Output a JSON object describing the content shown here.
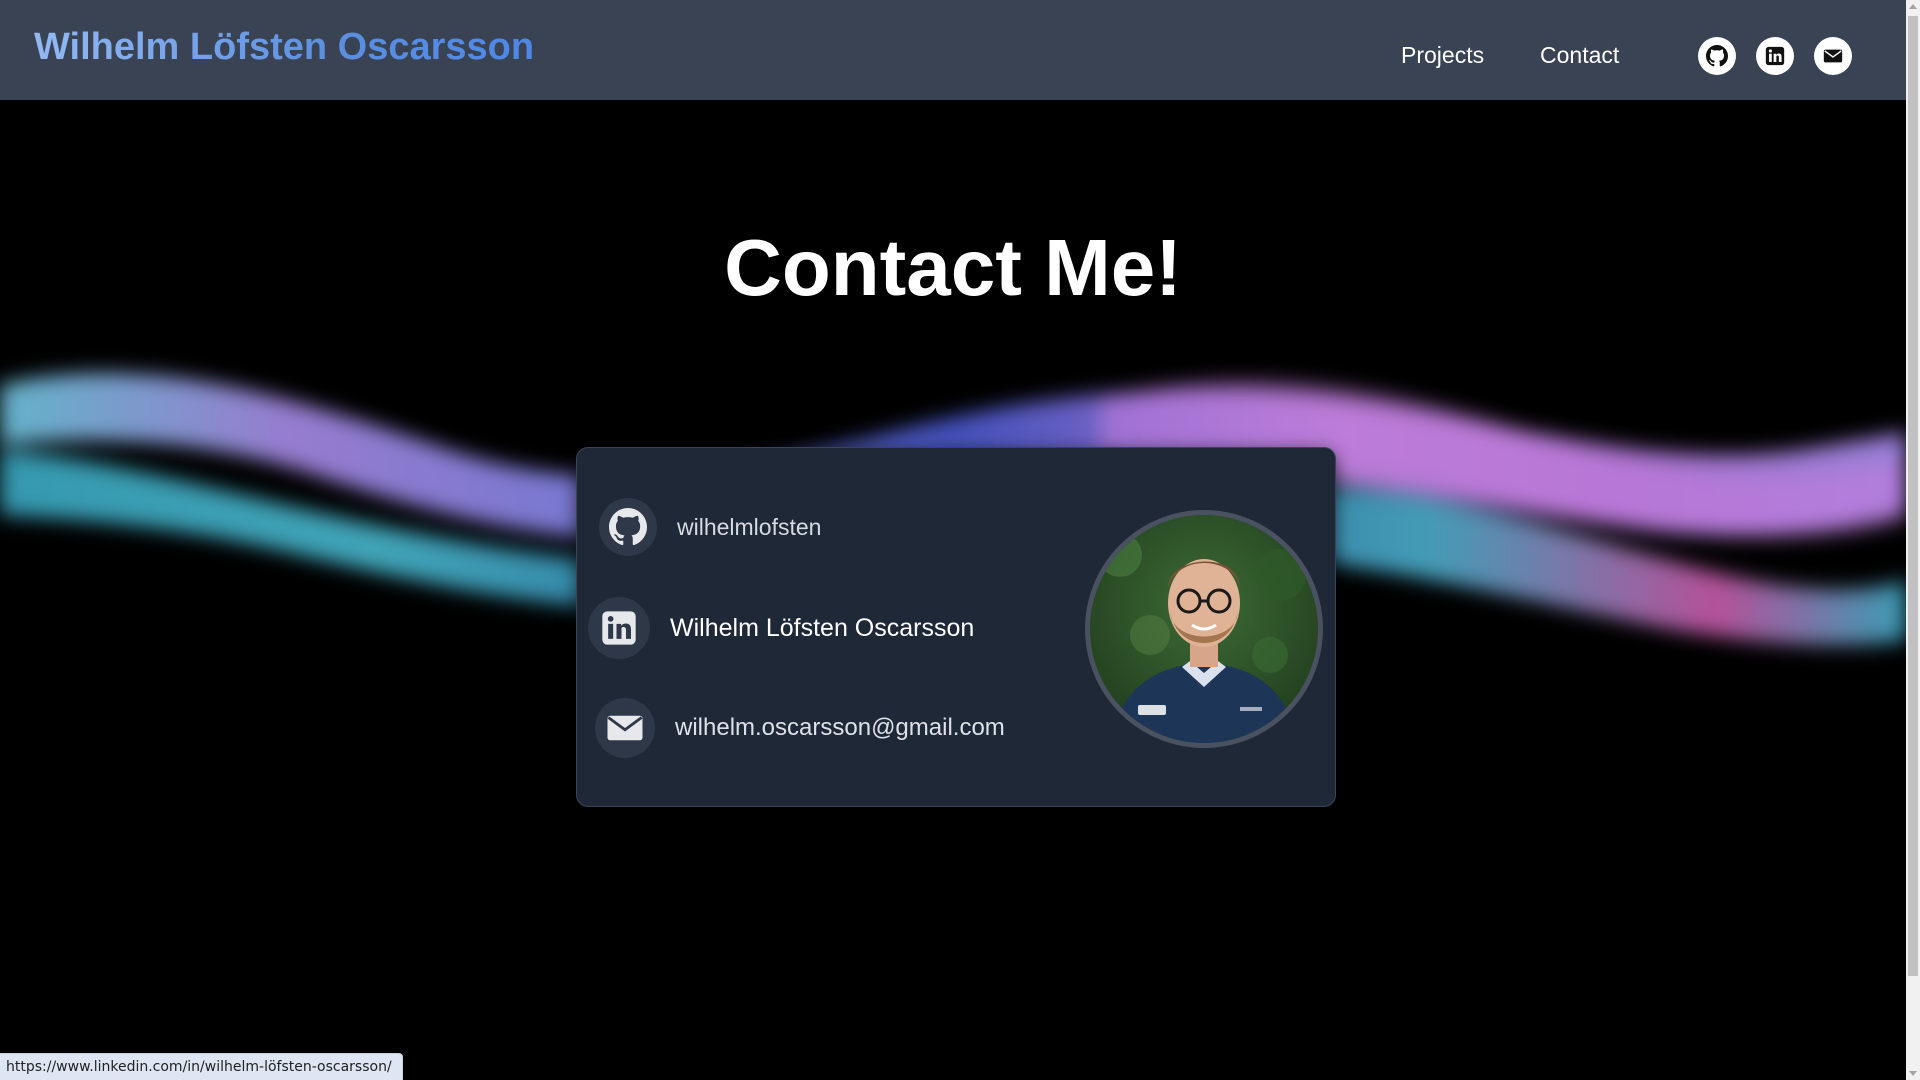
{
  "header": {
    "brand": "Wilhelm Löfsten Oscarsson",
    "nav": [
      {
        "label": "Projects"
      },
      {
        "label": "Contact"
      }
    ],
    "social_icons": [
      "github-icon",
      "linkedin-icon",
      "mail-icon"
    ]
  },
  "main": {
    "heading": "Contact Me!",
    "contacts": [
      {
        "icon": "github-icon",
        "label": "wilhelmlofsten"
      },
      {
        "icon": "linkedin-icon",
        "label": "Wilhelm Löfsten Oscarsson"
      },
      {
        "icon": "mail-icon",
        "label": "wilhelm.oscarsson@gmail.com"
      }
    ],
    "avatar": "profile-photo"
  },
  "status_bar": {
    "url": "https://www.linkedin.com/in/wilhelm-löfsten-oscarsson/"
  },
  "colors": {
    "header_bg": "#3a4354",
    "card_bg": "#1f2837",
    "brand_gradient_start": "#93b9f2",
    "brand_gradient_end": "#4f87e6",
    "wave_purple": "#b07ee6",
    "wave_cyan": "#4fb7d6",
    "page_bg": "#000000"
  }
}
